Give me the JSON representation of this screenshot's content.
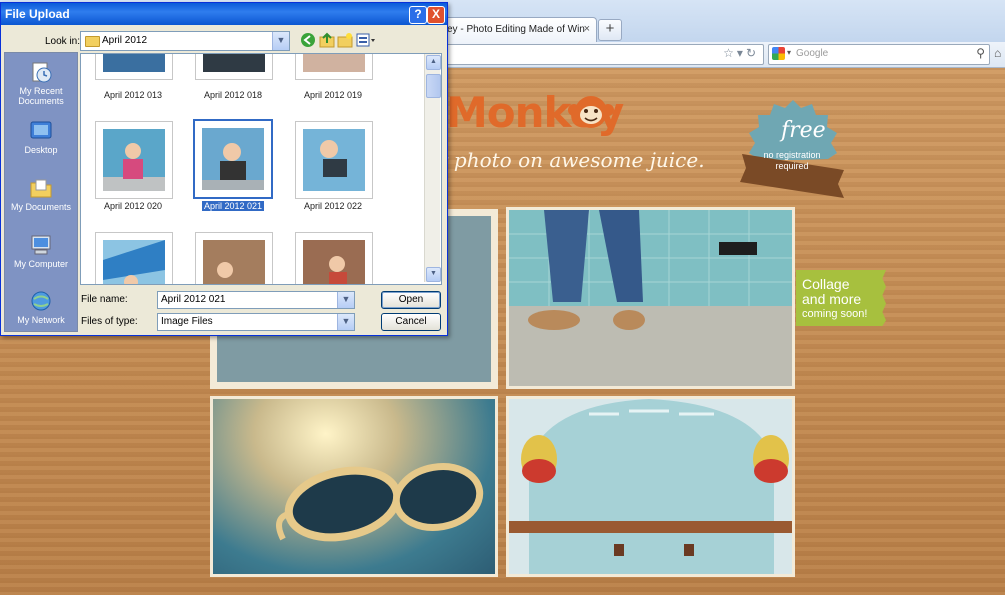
{
  "browser": {
    "tab_title": "ey - Photo Editing Made of Win",
    "tab_close": "×",
    "new_tab": "+",
    "search_placeholder": "Google"
  },
  "page": {
    "logo": "Monkey",
    "tagline": "r photo on awesome juice.",
    "badge": {
      "free": "free",
      "ribbon_line1": "no registration",
      "ribbon_line2": "required"
    },
    "collage": {
      "line1": "Collage",
      "line2": "and more",
      "line3": "coming soon!"
    },
    "colors": {
      "logo": "#e06a2a",
      "badge": "#6fa7b3",
      "ribbon": "#7a4a26",
      "collage_tag": "#a7c03e"
    }
  },
  "dialog": {
    "title": "File Upload",
    "help": "?",
    "close": "X",
    "look_in_label": "Look in:",
    "look_in_value": "April 2012",
    "places": [
      {
        "label1": "My Recent",
        "label2": "Documents",
        "icon": "recent-documents-icon"
      },
      {
        "label1": "Desktop",
        "label2": "",
        "icon": "desktop-icon"
      },
      {
        "label1": "My Documents",
        "label2": "",
        "icon": "my-documents-icon"
      },
      {
        "label1": "My Computer",
        "label2": "",
        "icon": "my-computer-icon"
      },
      {
        "label1": "My Network",
        "label2": "",
        "icon": "my-network-icon"
      }
    ],
    "files": [
      {
        "name": "April 2012 013"
      },
      {
        "name": "April 2012 018"
      },
      {
        "name": "April 2012 019"
      },
      {
        "name": "April 2012 020"
      },
      {
        "name": "April 2012 021",
        "selected": true
      },
      {
        "name": "April 2012 022"
      },
      {
        "name": ""
      },
      {
        "name": ""
      },
      {
        "name": ""
      }
    ],
    "file_name_label": "File name:",
    "file_name_value": "April 2012 021",
    "files_of_type_label": "Files of type:",
    "files_of_type_value": "Image Files",
    "open_button": "Open",
    "cancel_button": "Cancel"
  }
}
